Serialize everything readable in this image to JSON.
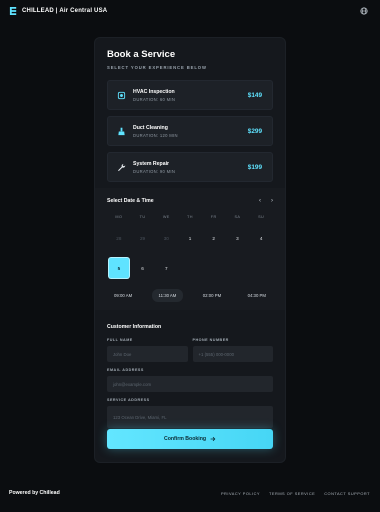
{
  "brand": {
    "name": "CHILLEAD | Air Central USA",
    "icon": "chillead-logo-icon"
  },
  "header": {
    "globe_icon": "globe-icon"
  },
  "booking": {
    "title": "Book a Service",
    "subtitle": "SELECT YOUR EXPERIENCE BELOW",
    "services": [
      {
        "name": "HVAC Inspection",
        "duration": "DURATION: 60 MIN",
        "price": "$149",
        "icon": "thermostat-icon"
      },
      {
        "name": "Duct Cleaning",
        "duration": "DURATION: 120 MIN",
        "price": "$299",
        "icon": "brush-icon"
      },
      {
        "name": "System Repair",
        "duration": "DURATION: 90 MIN",
        "price": "$199",
        "icon": "wrench-icon"
      }
    ]
  },
  "datetime": {
    "title": "Select Date & Time",
    "prev_icon": "chevron-left-icon",
    "next_icon": "chevron-right-icon",
    "weekdays": [
      "MO",
      "TU",
      "WE",
      "TH",
      "FR",
      "SA",
      "SU"
    ],
    "days": [
      {
        "label": "28",
        "muted": true
      },
      {
        "label": "29",
        "muted": true
      },
      {
        "label": "30",
        "muted": true
      },
      {
        "label": "1"
      },
      {
        "label": "2"
      },
      {
        "label": "3"
      },
      {
        "label": "4"
      },
      {
        "label": "5",
        "selected": true
      },
      {
        "label": "6"
      },
      {
        "label": "7"
      }
    ],
    "times": [
      {
        "label": "09:00 AM"
      },
      {
        "label": "11:30 AM",
        "active": true
      },
      {
        "label": "02:00 PM"
      },
      {
        "label": "04:30 PM"
      }
    ]
  },
  "customer": {
    "title": "Customer Information",
    "full_name_label": "FULL NAME",
    "full_name_placeholder": "John Doe",
    "phone_label": "PHONE NUMBER",
    "phone_placeholder": "+1 (555) 000-0000",
    "email_label": "EMAIL ADDRESS",
    "email_placeholder": "john@example.com",
    "address_label": "SERVICE ADDRESS",
    "address_placeholder": "123 Ocean Drive, Miami, FL"
  },
  "confirm": {
    "label": "Confirm Booking",
    "icon": "arrow-right-icon"
  },
  "footer": {
    "powered": "Powered by Chillead",
    "links": [
      "PRIVACY POLICY",
      "TERMS OF SERVICE",
      "CONTACT SUPPORT"
    ]
  },
  "colors": {
    "accent": "#5fe3ff",
    "background": "#0b0d10",
    "card": "#15181d"
  }
}
